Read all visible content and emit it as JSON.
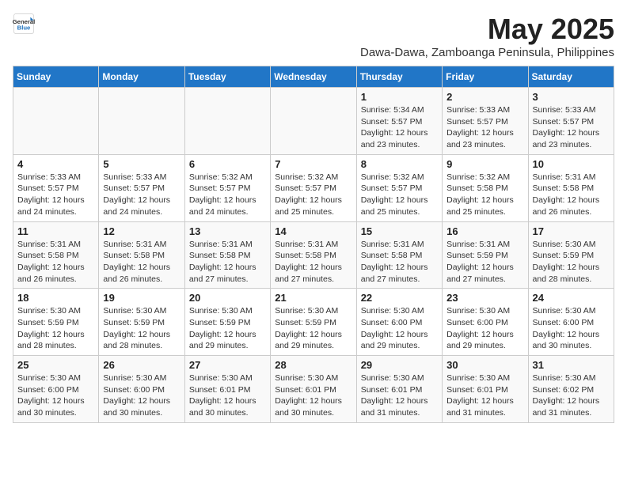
{
  "logo": {
    "general": "General",
    "blue": "Blue"
  },
  "title": "May 2025",
  "location": "Dawa-Dawa, Zamboanga Peninsula, Philippines",
  "headers": [
    "Sunday",
    "Monday",
    "Tuesday",
    "Wednesday",
    "Thursday",
    "Friday",
    "Saturday"
  ],
  "weeks": [
    [
      {
        "day": "",
        "info": ""
      },
      {
        "day": "",
        "info": ""
      },
      {
        "day": "",
        "info": ""
      },
      {
        "day": "",
        "info": ""
      },
      {
        "day": "1",
        "info": "Sunrise: 5:34 AM\nSunset: 5:57 PM\nDaylight: 12 hours\nand 23 minutes."
      },
      {
        "day": "2",
        "info": "Sunrise: 5:33 AM\nSunset: 5:57 PM\nDaylight: 12 hours\nand 23 minutes."
      },
      {
        "day": "3",
        "info": "Sunrise: 5:33 AM\nSunset: 5:57 PM\nDaylight: 12 hours\nand 23 minutes."
      }
    ],
    [
      {
        "day": "4",
        "info": "Sunrise: 5:33 AM\nSunset: 5:57 PM\nDaylight: 12 hours\nand 24 minutes."
      },
      {
        "day": "5",
        "info": "Sunrise: 5:33 AM\nSunset: 5:57 PM\nDaylight: 12 hours\nand 24 minutes."
      },
      {
        "day": "6",
        "info": "Sunrise: 5:32 AM\nSunset: 5:57 PM\nDaylight: 12 hours\nand 24 minutes."
      },
      {
        "day": "7",
        "info": "Sunrise: 5:32 AM\nSunset: 5:57 PM\nDaylight: 12 hours\nand 25 minutes."
      },
      {
        "day": "8",
        "info": "Sunrise: 5:32 AM\nSunset: 5:57 PM\nDaylight: 12 hours\nand 25 minutes."
      },
      {
        "day": "9",
        "info": "Sunrise: 5:32 AM\nSunset: 5:58 PM\nDaylight: 12 hours\nand 25 minutes."
      },
      {
        "day": "10",
        "info": "Sunrise: 5:31 AM\nSunset: 5:58 PM\nDaylight: 12 hours\nand 26 minutes."
      }
    ],
    [
      {
        "day": "11",
        "info": "Sunrise: 5:31 AM\nSunset: 5:58 PM\nDaylight: 12 hours\nand 26 minutes."
      },
      {
        "day": "12",
        "info": "Sunrise: 5:31 AM\nSunset: 5:58 PM\nDaylight: 12 hours\nand 26 minutes."
      },
      {
        "day": "13",
        "info": "Sunrise: 5:31 AM\nSunset: 5:58 PM\nDaylight: 12 hours\nand 27 minutes."
      },
      {
        "day": "14",
        "info": "Sunrise: 5:31 AM\nSunset: 5:58 PM\nDaylight: 12 hours\nand 27 minutes."
      },
      {
        "day": "15",
        "info": "Sunrise: 5:31 AM\nSunset: 5:58 PM\nDaylight: 12 hours\nand 27 minutes."
      },
      {
        "day": "16",
        "info": "Sunrise: 5:31 AM\nSunset: 5:59 PM\nDaylight: 12 hours\nand 27 minutes."
      },
      {
        "day": "17",
        "info": "Sunrise: 5:30 AM\nSunset: 5:59 PM\nDaylight: 12 hours\nand 28 minutes."
      }
    ],
    [
      {
        "day": "18",
        "info": "Sunrise: 5:30 AM\nSunset: 5:59 PM\nDaylight: 12 hours\nand 28 minutes."
      },
      {
        "day": "19",
        "info": "Sunrise: 5:30 AM\nSunset: 5:59 PM\nDaylight: 12 hours\nand 28 minutes."
      },
      {
        "day": "20",
        "info": "Sunrise: 5:30 AM\nSunset: 5:59 PM\nDaylight: 12 hours\nand 29 minutes."
      },
      {
        "day": "21",
        "info": "Sunrise: 5:30 AM\nSunset: 5:59 PM\nDaylight: 12 hours\nand 29 minutes."
      },
      {
        "day": "22",
        "info": "Sunrise: 5:30 AM\nSunset: 6:00 PM\nDaylight: 12 hours\nand 29 minutes."
      },
      {
        "day": "23",
        "info": "Sunrise: 5:30 AM\nSunset: 6:00 PM\nDaylight: 12 hours\nand 29 minutes."
      },
      {
        "day": "24",
        "info": "Sunrise: 5:30 AM\nSunset: 6:00 PM\nDaylight: 12 hours\nand 30 minutes."
      }
    ],
    [
      {
        "day": "25",
        "info": "Sunrise: 5:30 AM\nSunset: 6:00 PM\nDaylight: 12 hours\nand 30 minutes."
      },
      {
        "day": "26",
        "info": "Sunrise: 5:30 AM\nSunset: 6:00 PM\nDaylight: 12 hours\nand 30 minutes."
      },
      {
        "day": "27",
        "info": "Sunrise: 5:30 AM\nSunset: 6:01 PM\nDaylight: 12 hours\nand 30 minutes."
      },
      {
        "day": "28",
        "info": "Sunrise: 5:30 AM\nSunset: 6:01 PM\nDaylight: 12 hours\nand 30 minutes."
      },
      {
        "day": "29",
        "info": "Sunrise: 5:30 AM\nSunset: 6:01 PM\nDaylight: 12 hours\nand 31 minutes."
      },
      {
        "day": "30",
        "info": "Sunrise: 5:30 AM\nSunset: 6:01 PM\nDaylight: 12 hours\nand 31 minutes."
      },
      {
        "day": "31",
        "info": "Sunrise: 5:30 AM\nSunset: 6:02 PM\nDaylight: 12 hours\nand 31 minutes."
      }
    ]
  ]
}
